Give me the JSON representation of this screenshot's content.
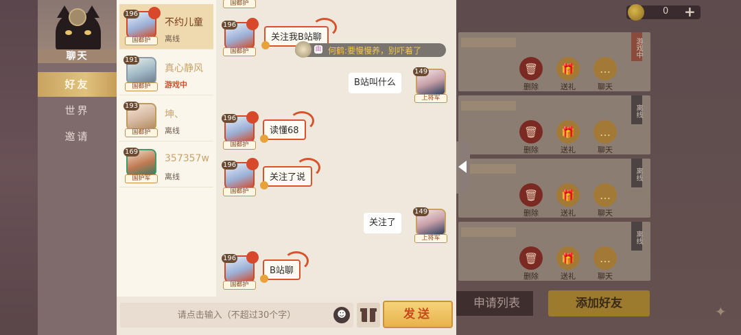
{
  "coins": {
    "amount": "0"
  },
  "sidebar": {
    "title": "聊天",
    "tabs": [
      {
        "label": "好友",
        "active": true
      },
      {
        "label": "世界",
        "active": false
      },
      {
        "label": "邀请",
        "active": false
      }
    ]
  },
  "friends": [
    {
      "level": "196",
      "rank": "国都护",
      "name": "不约儿童",
      "status": "离线",
      "selected": true
    },
    {
      "level": "191",
      "rank": "国都护",
      "name": "真心静风",
      "status": "游戏中",
      "selected": false
    },
    {
      "level": "193",
      "rank": "国都护",
      "name": "坤、",
      "status": "离线",
      "selected": false
    },
    {
      "level": "169",
      "rank": "国护军",
      "name": "357357w",
      "status": "离线",
      "selected": false
    }
  ],
  "chat": {
    "system_notice": "何鹤:要慢慢养，别吓着了",
    "system_badge": "由",
    "messages": [
      {
        "side": "left",
        "text": "关注我B站聊",
        "level": "196",
        "rank": "国都护"
      },
      {
        "side": "right",
        "text": "B站叫什么",
        "level": "149",
        "rank": "上将军"
      },
      {
        "side": "left",
        "text": "读懂68",
        "level": "196",
        "rank": "国都护"
      },
      {
        "side": "left",
        "text": "关注了说",
        "level": "196",
        "rank": "国都护"
      },
      {
        "side": "right",
        "text": "关注了",
        "level": "149",
        "rank": "上将军"
      },
      {
        "side": "left",
        "text": "B站聊",
        "level": "196",
        "rank": "国都护"
      }
    ],
    "top_partial_rank": "国都护"
  },
  "input": {
    "placeholder": "请点击输入（不超过30个字）",
    "send_label": "发送"
  },
  "friend_cards": {
    "tags": [
      "游戏中",
      "离线",
      "离线",
      "离线"
    ],
    "delete_label": "删除",
    "gift_label": "送礼",
    "chat_label": "聊天"
  },
  "bottom_buttons": {
    "requests_label": "申请列表",
    "add_friend_label": "添加好友"
  }
}
